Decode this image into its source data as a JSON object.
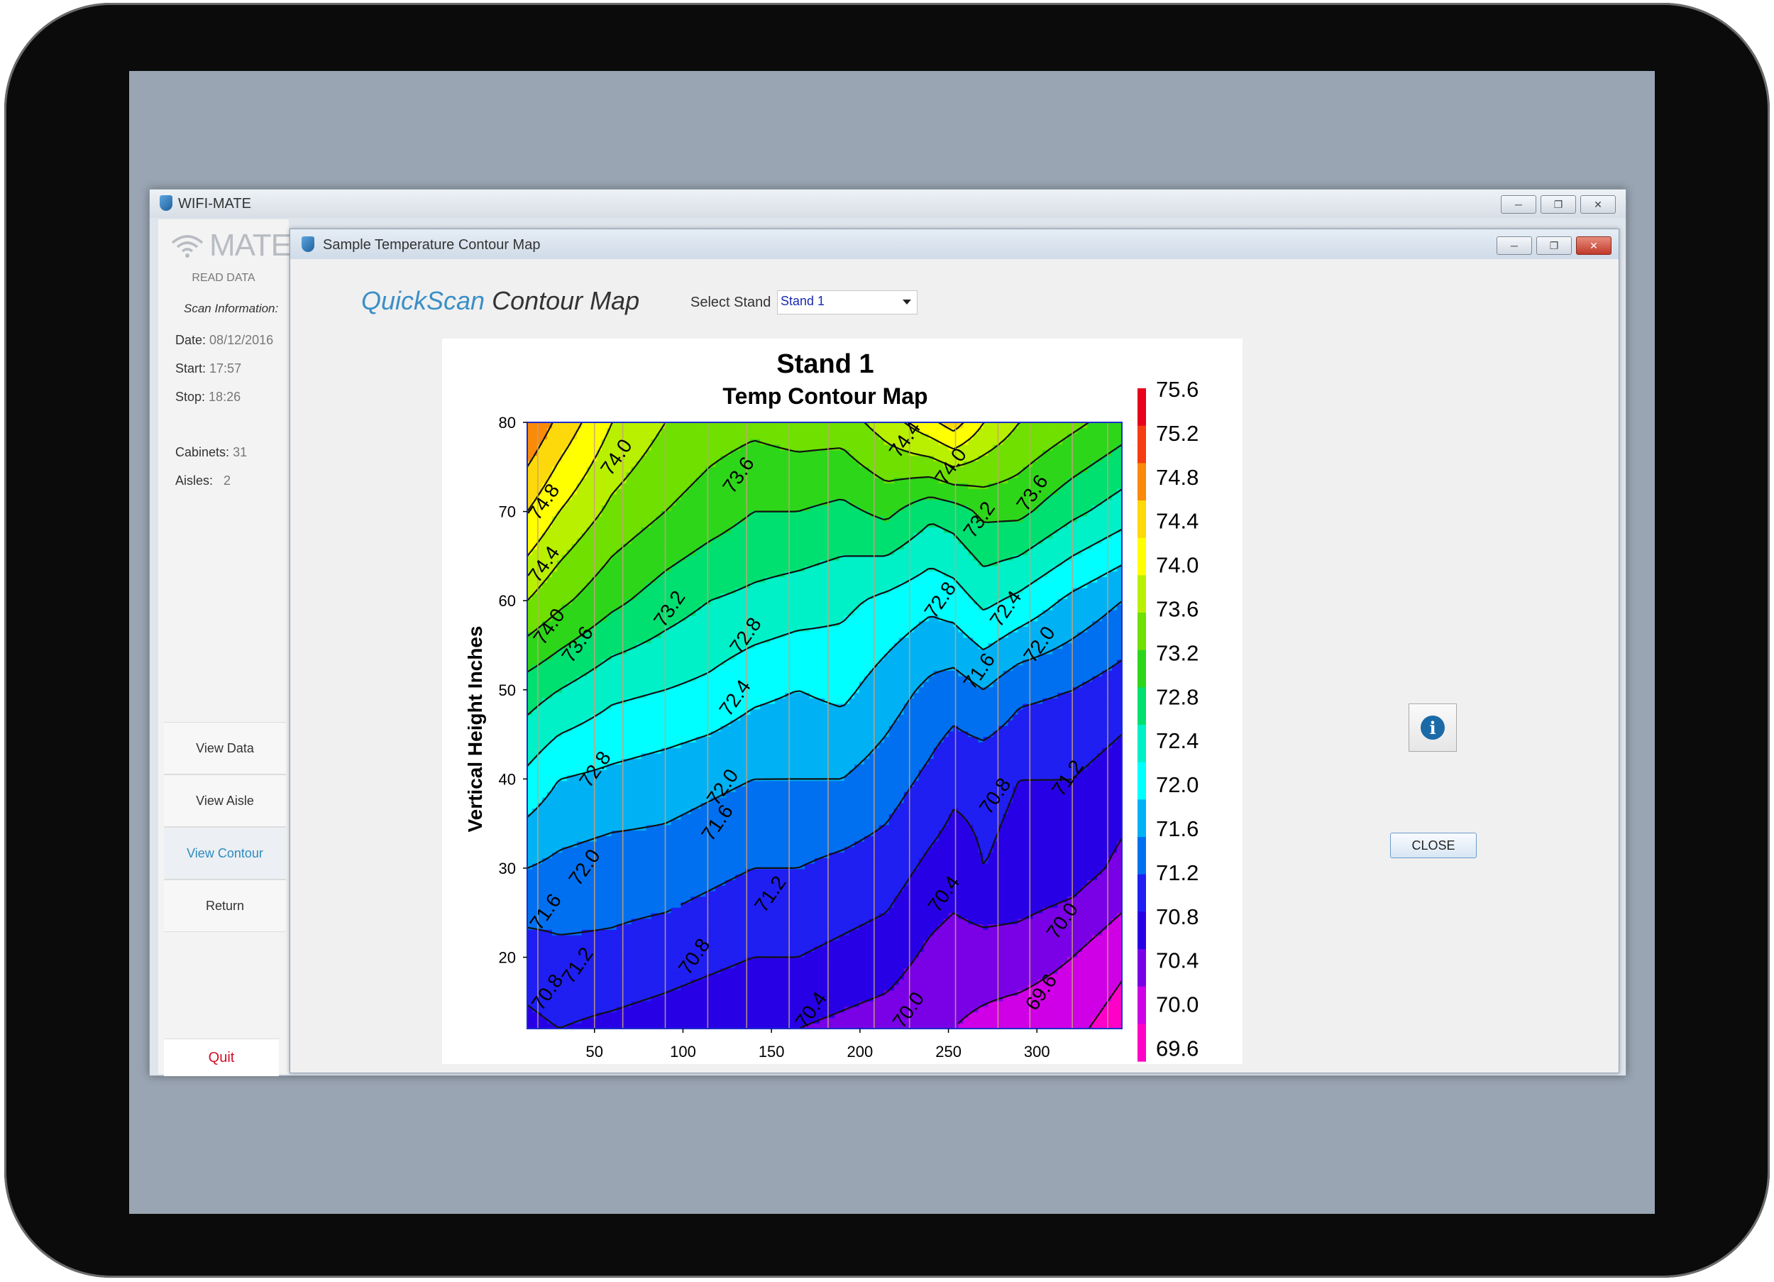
{
  "outer_window": {
    "title": "WIFI-MATE"
  },
  "sidebar": {
    "logo_text": "MATE",
    "subtitle": "READ DATA",
    "scan_info_heading": "Scan Information:",
    "fields": [
      {
        "label": "Date:",
        "value": "08/12/2016"
      },
      {
        "label": "Start:",
        "value": "17:57"
      },
      {
        "label": "Stop:",
        "value": "18:26"
      },
      {
        "label": "Cabinets:",
        "value": "31"
      },
      {
        "label": "Aisles:",
        "value": "2"
      }
    ],
    "nav": [
      "View Data",
      "View Aisle",
      "View Contour",
      "Return"
    ],
    "active_nav": "View Contour",
    "quit_label": "Quit"
  },
  "inner_window": {
    "title": "Sample Temperature Contour Map"
  },
  "header": {
    "title_highlight": "QuickScan",
    "title_rest": "Contour Map",
    "select_label": "Select Stand",
    "select_value": "Stand 1"
  },
  "buttons": {
    "close_label": "CLOSE"
  },
  "colors": {
    "accent": "#3a8fc7",
    "quit": "#d0102a"
  },
  "chart_data": {
    "type": "heatmap",
    "title": "Stand 1",
    "subtitle": "Temp Contour Map",
    "ylabel": "Vertical Height Inches",
    "xlabel": "",
    "xlim": [
      12,
      348
    ],
    "ylim": [
      12,
      80
    ],
    "x_ticks": [
      50,
      100,
      150,
      200,
      250,
      300
    ],
    "y_ticks": [
      20,
      30,
      40,
      50,
      60,
      70,
      80
    ],
    "colorbar": {
      "levels": [
        75.6,
        75.2,
        74.8,
        74.4,
        74.0,
        73.6,
        73.2,
        72.8,
        72.4,
        72.0,
        71.6,
        71.2,
        70.8,
        70.4,
        70.0,
        69.6
      ],
      "colors": [
        "#e8001c",
        "#f43d12",
        "#f98a0a",
        "#fdd80a",
        "#ffff00",
        "#b8f000",
        "#6fe000",
        "#2ed61a",
        "#00e070",
        "#00f0c8",
        "#00ffff",
        "#00b2f4",
        "#0070f0",
        "#1f1ff2",
        "#2800e6",
        "#7a00e6",
        "#d000e6",
        "#ff00c8"
      ]
    },
    "x": [
      12,
      30,
      60,
      90,
      115,
      140,
      165,
      190,
      215,
      240,
      253,
      270,
      290,
      320,
      348
    ],
    "y": [
      12,
      20,
      30,
      40,
      50,
      60,
      70,
      80
    ],
    "z": [
      [
        70.7,
        70.8,
        70.7,
        70.6,
        70.5,
        70.4,
        70.4,
        70.3,
        70.2,
        70.0,
        70.0,
        69.9,
        69.8,
        69.7,
        69.4
      ],
      [
        71.0,
        71.1,
        71.1,
        71.0,
        70.9,
        70.8,
        70.8,
        70.7,
        70.6,
        70.3,
        70.2,
        70.2,
        70.2,
        70.0,
        69.7
      ],
      [
        71.6,
        71.5,
        71.4,
        71.4,
        71.3,
        71.2,
        71.2,
        71.1,
        71.0,
        70.7,
        70.6,
        70.8,
        70.7,
        70.6,
        70.3
      ],
      [
        72.3,
        72.0,
        71.9,
        71.8,
        71.7,
        71.6,
        71.6,
        71.6,
        71.4,
        71.1,
        70.9,
        70.9,
        70.8,
        70.8,
        70.6
      ],
      [
        73.0,
        72.8,
        72.5,
        72.4,
        72.3,
        72.1,
        72.0,
        72.1,
        71.8,
        71.5,
        71.4,
        71.6,
        71.3,
        71.2,
        71.0
      ],
      [
        74.0,
        73.7,
        73.3,
        73.0,
        72.8,
        72.7,
        72.6,
        72.5,
        72.3,
        72.1,
        72.2,
        72.5,
        72.3,
        71.9,
        71.6
      ],
      [
        74.8,
        74.4,
        73.9,
        73.6,
        73.4,
        73.2,
        73.2,
        73.1,
        73.3,
        72.9,
        73.0,
        73.3,
        73.3,
        72.9,
        72.6
      ],
      [
        75.6,
        75.1,
        74.4,
        74.0,
        73.8,
        73.7,
        73.8,
        73.8,
        74.2,
        74.7,
        75.0,
        74.4,
        74.0,
        73.7,
        73.4
      ]
    ],
    "contour_labels": [
      {
        "text": "74.8",
        "x": 22,
        "y": 71
      },
      {
        "text": "74.4",
        "x": 22,
        "y": 64
      },
      {
        "text": "74.0",
        "x": 25,
        "y": 57
      },
      {
        "text": "74.0",
        "x": 63,
        "y": 76
      },
      {
        "text": "73.6",
        "x": 41,
        "y": 55
      },
      {
        "text": "73.6",
        "x": 132,
        "y": 74
      },
      {
        "text": "73.2",
        "x": 93,
        "y": 59
      },
      {
        "text": "73.2",
        "x": 268,
        "y": 69
      },
      {
        "text": "72.8",
        "x": 136,
        "y": 56
      },
      {
        "text": "72.8",
        "x": 51,
        "y": 41
      },
      {
        "text": "72.4",
        "x": 130,
        "y": 49
      },
      {
        "text": "72.4",
        "x": 283,
        "y": 59
      },
      {
        "text": "72.0",
        "x": 45,
        "y": 30
      },
      {
        "text": "72.0",
        "x": 123,
        "y": 39
      },
      {
        "text": "72.0",
        "x": 302,
        "y": 55
      },
      {
        "text": "71.6",
        "x": 23,
        "y": 25
      },
      {
        "text": "71.6",
        "x": 120,
        "y": 35
      },
      {
        "text": "71.6",
        "x": 268,
        "y": 52
      },
      {
        "text": "71.2",
        "x": 41,
        "y": 19
      },
      {
        "text": "71.2",
        "x": 150,
        "y": 27
      },
      {
        "text": "71.2",
        "x": 318,
        "y": 40
      },
      {
        "text": "70.8",
        "x": 24,
        "y": 16
      },
      {
        "text": "70.8",
        "x": 107,
        "y": 20
      },
      {
        "text": "70.8",
        "x": 277,
        "y": 38
      },
      {
        "text": "70.4",
        "x": 173,
        "y": 14
      },
      {
        "text": "70.4",
        "x": 248,
        "y": 27
      },
      {
        "text": "70.0",
        "x": 228,
        "y": 14
      },
      {
        "text": "70.0",
        "x": 315,
        "y": 24
      },
      {
        "text": "69.6",
        "x": 303,
        "y": 16
      },
      {
        "text": "74.4",
        "x": 226,
        "y": 78
      },
      {
        "text": "74.0",
        "x": 252,
        "y": 75
      },
      {
        "text": "73.6",
        "x": 298,
        "y": 72
      },
      {
        "text": "72.8",
        "x": 246,
        "y": 60
      }
    ],
    "vertical_markers": [
      18,
      50,
      66,
      90,
      114,
      136,
      160,
      182,
      208,
      228,
      254,
      278,
      296,
      320,
      340
    ]
  }
}
